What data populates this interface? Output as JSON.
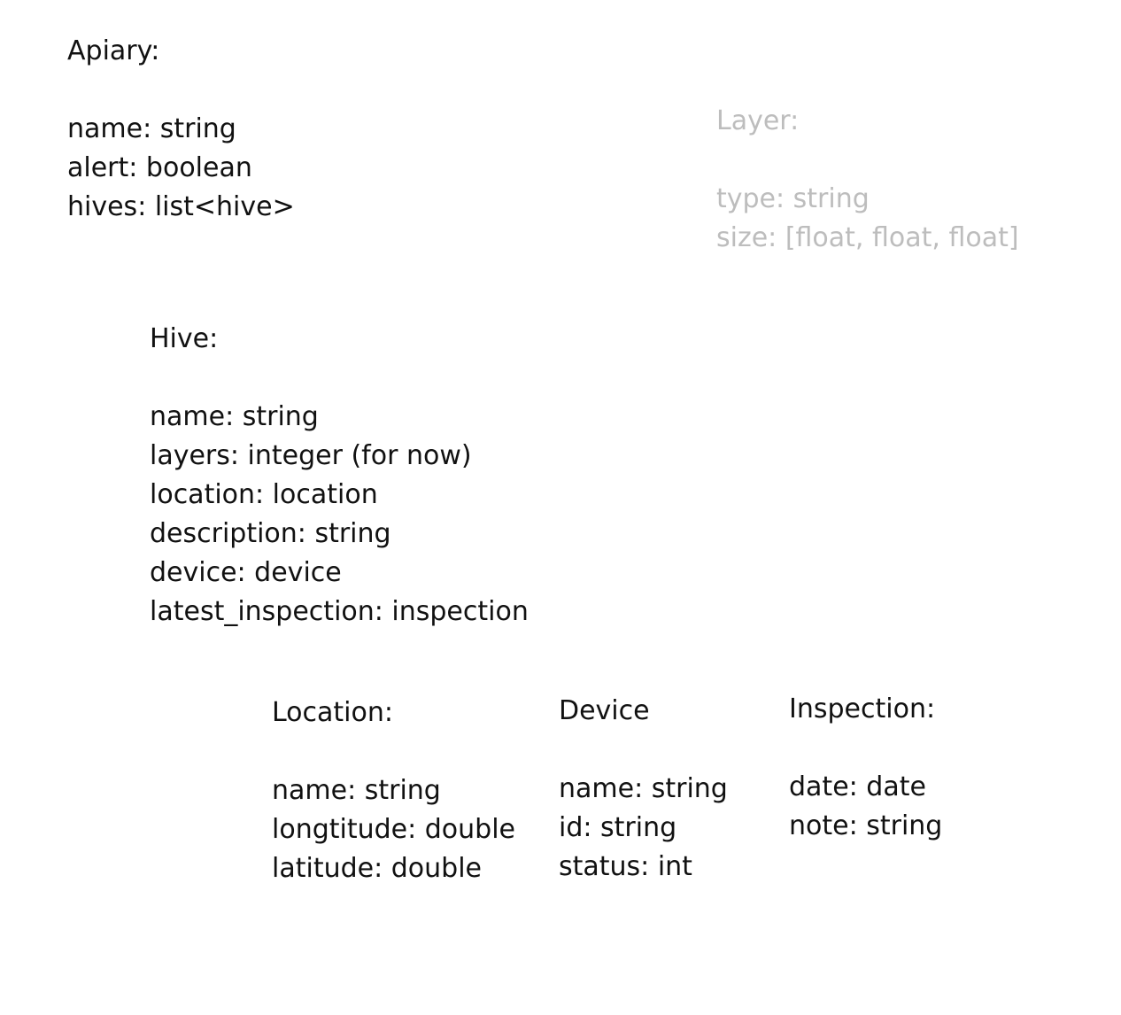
{
  "entities": {
    "apiary": {
      "title": "Apiary:",
      "fields": [
        "name: string",
        "alert: boolean",
        "hives: list<hive>"
      ]
    },
    "layer": {
      "title": "Layer:",
      "fields": [
        "type: string",
        "size: [float, float, float]"
      ],
      "color": "#bdbdbd"
    },
    "hive": {
      "title": "Hive:",
      "fields": [
        "name: string",
        "layers: integer (for now)",
        "location: location",
        "description: string",
        "device: device",
        "latest_inspection: inspection"
      ]
    },
    "location": {
      "title": "Location:",
      "fields": [
        "name: string",
        "longtitude: double",
        "latitude: double"
      ]
    },
    "device": {
      "title": "Device",
      "fields": [
        "name: string",
        "id: string",
        "status: int"
      ]
    },
    "inspection": {
      "title": "Inspection:",
      "fields": [
        "date: date",
        "note: string"
      ]
    }
  }
}
